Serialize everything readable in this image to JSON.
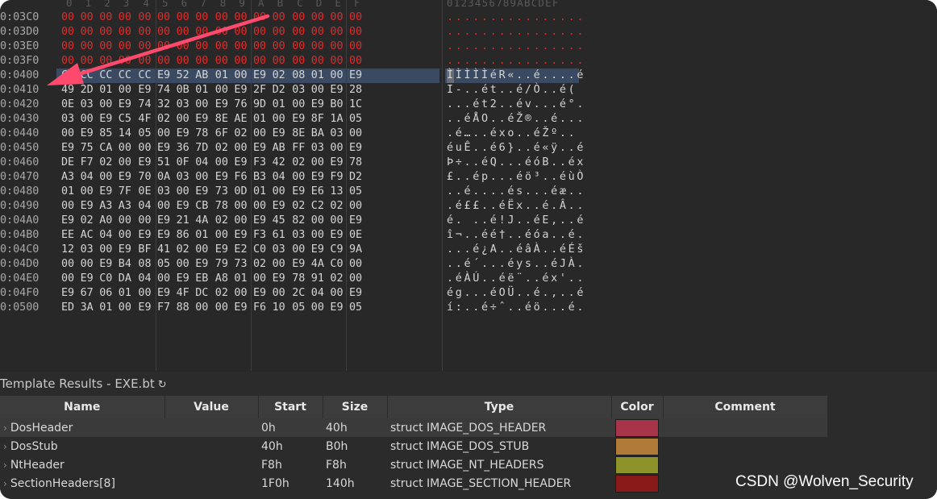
{
  "hex_view": {
    "column_headers": [
      "0",
      "1",
      "2",
      "3",
      "4",
      "5",
      "6",
      "7",
      "8",
      "9",
      "A",
      "B",
      "C",
      "D",
      "E",
      "F"
    ],
    "ascii_header": "0123456789ABCDEF",
    "colors": {
      "zero_bytes": "#e32a2a",
      "selection": "#3a4a63"
    },
    "selected_row_index": 4,
    "rows": [
      {
        "address": "0:03C0",
        "bytes": [
          "00",
          "00",
          "00",
          "00",
          "00",
          "00",
          "00",
          "00",
          "00",
          "00",
          "00",
          "00",
          "00",
          "00",
          "00",
          "00"
        ],
        "ascii": "................",
        "red": true
      },
      {
        "address": "0:03D0",
        "bytes": [
          "00",
          "00",
          "00",
          "00",
          "00",
          "00",
          "00",
          "00",
          "00",
          "00",
          "00",
          "00",
          "00",
          "00",
          "00",
          "00"
        ],
        "ascii": "................",
        "red": true
      },
      {
        "address": "0:03E0",
        "bytes": [
          "00",
          "00",
          "00",
          "00",
          "00",
          "00",
          "00",
          "00",
          "00",
          "00",
          "00",
          "00",
          "00",
          "00",
          "00",
          "00"
        ],
        "ascii": "................",
        "red": true
      },
      {
        "address": "0:03F0",
        "bytes": [
          "00",
          "00",
          "00",
          "00",
          "00",
          "00",
          "00",
          "00",
          "00",
          "00",
          "00",
          "00",
          "00",
          "00",
          "00",
          "00"
        ],
        "ascii": "................",
        "red": true
      },
      {
        "address": "0:0400",
        "bytes": [
          "CC",
          "CC",
          "CC",
          "CC",
          "CC",
          "E9",
          "52",
          "AB",
          "01",
          "00",
          "E9",
          "02",
          "08",
          "01",
          "00",
          "E9"
        ],
        "ascii": "ÌÌÌÌÌéR«..é....é",
        "red": false
      },
      {
        "address": "0:0410",
        "bytes": [
          "49",
          "2D",
          "01",
          "00",
          "E9",
          "74",
          "0B",
          "01",
          "00",
          "E9",
          "2F",
          "D2",
          "03",
          "00",
          "E9",
          "28"
        ],
        "ascii": "I-..ét..é/Ò..é(",
        "red": false
      },
      {
        "address": "0:0420",
        "bytes": [
          "0E",
          "03",
          "00",
          "E9",
          "74",
          "32",
          "03",
          "00",
          "E9",
          "76",
          "9D",
          "01",
          "00",
          "E9",
          "B0",
          "1C"
        ],
        "ascii": "...ét2..év...é°.",
        "red": false
      },
      {
        "address": "0:0430",
        "bytes": [
          "03",
          "00",
          "E9",
          "C5",
          "4F",
          "02",
          "00",
          "E9",
          "8E",
          "AE",
          "01",
          "00",
          "E9",
          "8F",
          "1A",
          "05"
        ],
        "ascii": "..éÅO..éŽ®..é...",
        "red": false
      },
      {
        "address": "0:0440",
        "bytes": [
          "00",
          "E9",
          "85",
          "14",
          "05",
          "00",
          "E9",
          "78",
          "6F",
          "02",
          "00",
          "E9",
          "8E",
          "BA",
          "03",
          "00"
        ],
        "ascii": ".é…..éxo..éŽº..",
        "red": false
      },
      {
        "address": "0:0450",
        "bytes": [
          "E9",
          "75",
          "CA",
          "00",
          "00",
          "E9",
          "36",
          "7D",
          "02",
          "00",
          "E9",
          "AB",
          "FF",
          "03",
          "00",
          "E9"
        ],
        "ascii": "éuÊ..é6}..é«ÿ..é",
        "red": false
      },
      {
        "address": "0:0460",
        "bytes": [
          "DE",
          "F7",
          "02",
          "00",
          "E9",
          "51",
          "0F",
          "04",
          "00",
          "E9",
          "F3",
          "42",
          "02",
          "00",
          "E9",
          "78"
        ],
        "ascii": "Þ÷..éQ...éóB..éx",
        "red": false
      },
      {
        "address": "0:0470",
        "bytes": [
          "A3",
          "04",
          "00",
          "E9",
          "70",
          "0A",
          "03",
          "00",
          "E9",
          "F6",
          "B3",
          "04",
          "00",
          "E9",
          "F9",
          "D2"
        ],
        "ascii": "£..ép...éö³..éùÒ",
        "red": false
      },
      {
        "address": "0:0480",
        "bytes": [
          "01",
          "00",
          "E9",
          "7F",
          "0E",
          "03",
          "00",
          "E9",
          "73",
          "0D",
          "01",
          "00",
          "E9",
          "E6",
          "13",
          "05"
        ],
        "ascii": "..é....és...éæ..",
        "red": false
      },
      {
        "address": "0:0490",
        "bytes": [
          "00",
          "E9",
          "A3",
          "A3",
          "04",
          "00",
          "E9",
          "CB",
          "78",
          "00",
          "00",
          "E9",
          "02",
          "C2",
          "02",
          "00"
        ],
        "ascii": ".é££..éËx..é.Â..",
        "red": false
      },
      {
        "address": "0:04A0",
        "bytes": [
          "E9",
          "02",
          "A0",
          "00",
          "00",
          "E9",
          "21",
          "4A",
          "02",
          "00",
          "E9",
          "45",
          "82",
          "00",
          "00",
          "E9"
        ],
        "ascii": "é. ..é!J..éE,..é",
        "red": false
      },
      {
        "address": "0:04B0",
        "bytes": [
          "EE",
          "AC",
          "04",
          "00",
          "E9",
          "E9",
          "86",
          "01",
          "00",
          "E9",
          "F3",
          "61",
          "03",
          "00",
          "E9",
          "0E"
        ],
        "ascii": "î¬..éé†..éóa..é.",
        "red": false
      },
      {
        "address": "0:04C0",
        "bytes": [
          "12",
          "03",
          "00",
          "E9",
          "BF",
          "41",
          "02",
          "00",
          "E9",
          "E2",
          "C0",
          "03",
          "00",
          "E9",
          "C9",
          "9A"
        ],
        "ascii": "...é¿A..éâÀ..éÉš",
        "red": false
      },
      {
        "address": "0:04D0",
        "bytes": [
          "00",
          "00",
          "E9",
          "B4",
          "08",
          "05",
          "00",
          "E9",
          "79",
          "73",
          "02",
          "00",
          "E9",
          "4A",
          "C0",
          "00"
        ],
        "ascii": "..é´...éys..éJÀ.",
        "red": false
      },
      {
        "address": "0:04E0",
        "bytes": [
          "00",
          "E9",
          "C0",
          "DA",
          "04",
          "00",
          "E9",
          "EB",
          "A8",
          "01",
          "00",
          "E9",
          "78",
          "91",
          "02",
          "00"
        ],
        "ascii": ".éÀÚ..éë¨..éx'..",
        "red": false
      },
      {
        "address": "0:04F0",
        "bytes": [
          "E9",
          "67",
          "06",
          "01",
          "00",
          "E9",
          "4F",
          "DC",
          "02",
          "00",
          "E9",
          "00",
          "2C",
          "04",
          "00",
          "E9"
        ],
        "ascii": "ég...éOÜ..é.,..é",
        "red": false
      },
      {
        "address": "0:0500",
        "bytes": [
          "ED",
          "3A",
          "01",
          "00",
          "E9",
          "F7",
          "88",
          "00",
          "00",
          "E9",
          "F6",
          "10",
          "05",
          "00",
          "E9",
          "05"
        ],
        "ascii": "í:..é÷ˆ..éö...é.",
        "red": false
      }
    ]
  },
  "template_results": {
    "title": "Template Results - EXE.bt",
    "columns": [
      "Name",
      "Value",
      "Start",
      "Size",
      "Type",
      "Color",
      "Comment"
    ],
    "rows": [
      {
        "name": "DosHeader",
        "value": "",
        "start": "0h",
        "size": "40h",
        "type": "struct IMAGE_DOS_HEADER",
        "color": "#a8344a",
        "comment": ""
      },
      {
        "name": "DosStub",
        "value": "",
        "start": "40h",
        "size": "B0h",
        "type": "struct IMAGE_DOS_STUB",
        "color": "#b07a38",
        "comment": ""
      },
      {
        "name": "NtHeader",
        "value": "",
        "start": "F8h",
        "size": "F8h",
        "type": "struct IMAGE_NT_HEADERS",
        "color": "#8e9329",
        "comment": ""
      },
      {
        "name": "SectionHeaders[8]",
        "value": "",
        "start": "1F0h",
        "size": "140h",
        "type": "struct IMAGE_SECTION_HEADER",
        "color": "#8a1a1a",
        "comment": ""
      }
    ]
  },
  "annotation": {
    "arrow_color": "#ff4a6e"
  },
  "watermark": "CSDN @Wolven_Security"
}
